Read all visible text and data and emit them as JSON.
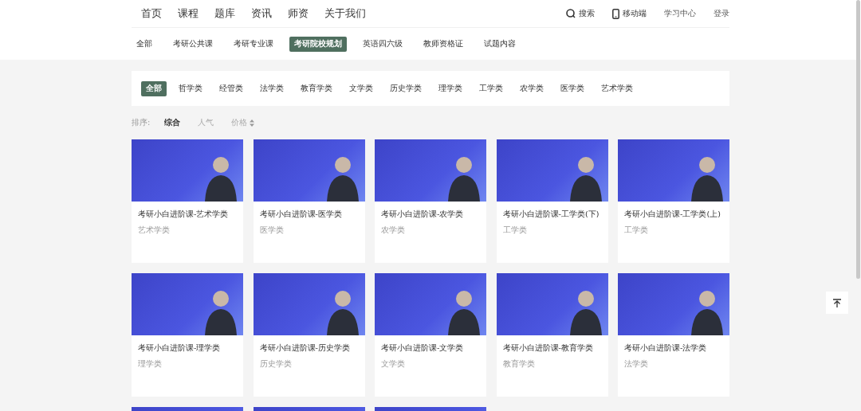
{
  "nav": {
    "links": [
      {
        "label": "首页"
      },
      {
        "label": "课程"
      },
      {
        "label": "题库"
      },
      {
        "label": "资讯"
      },
      {
        "label": "师资"
      },
      {
        "label": "关于我们"
      }
    ],
    "actions": [
      {
        "label": "搜索",
        "kind": "search"
      },
      {
        "label": "移动端",
        "kind": "phone"
      },
      {
        "label": "学习中心",
        "kind": "text"
      },
      {
        "label": "登录",
        "kind": "text"
      }
    ]
  },
  "subnav": [
    {
      "label": "全部",
      "selected": false
    },
    {
      "label": "考研公共课",
      "selected": false
    },
    {
      "label": "考研专业课",
      "selected": false
    },
    {
      "label": "考研院校规划",
      "selected": true
    },
    {
      "label": "英语四六级",
      "selected": false
    },
    {
      "label": "教师资格证",
      "selected": false
    },
    {
      "label": "试题内容",
      "selected": false
    }
  ],
  "categories": [
    {
      "label": "全部",
      "selected": true
    },
    {
      "label": "哲学类",
      "selected": false
    },
    {
      "label": "经管类",
      "selected": false
    },
    {
      "label": "法学类",
      "selected": false
    },
    {
      "label": "教育学类",
      "selected": false
    },
    {
      "label": "文学类",
      "selected": false
    },
    {
      "label": "历史学类",
      "selected": false
    },
    {
      "label": "理学类",
      "selected": false
    },
    {
      "label": "工学类",
      "selected": false
    },
    {
      "label": "农学类",
      "selected": false
    },
    {
      "label": "医学类",
      "selected": false
    },
    {
      "label": "艺术学类",
      "selected": false
    }
  ],
  "sort": {
    "label": "排序:",
    "options": [
      {
        "label": "综合",
        "selected": true,
        "kind": "plain"
      },
      {
        "label": "人气",
        "selected": false,
        "kind": "plain"
      },
      {
        "label": "价格",
        "selected": false,
        "kind": "price"
      }
    ]
  },
  "courses": [
    {
      "title": "考研小白进阶课-艺术学类",
      "category": "艺术学类"
    },
    {
      "title": "考研小白进阶课-医学类",
      "category": "医学类"
    },
    {
      "title": "考研小白进阶课-农学类",
      "category": "农学类"
    },
    {
      "title": "考研小白进阶课-工学类(下)",
      "category": "工学类"
    },
    {
      "title": "考研小白进阶课-工学类(上)",
      "category": "工学类"
    },
    {
      "title": "考研小白进阶课-理学类",
      "category": "理学类"
    },
    {
      "title": "考研小白进阶课-历史学类",
      "category": "历史学类"
    },
    {
      "title": "考研小白进阶课-文学类",
      "category": "文学类"
    },
    {
      "title": "考研小白进阶课-教育学类",
      "category": "教育学类"
    },
    {
      "title": "考研小白进阶课-法学类",
      "category": "法学类"
    }
  ]
}
